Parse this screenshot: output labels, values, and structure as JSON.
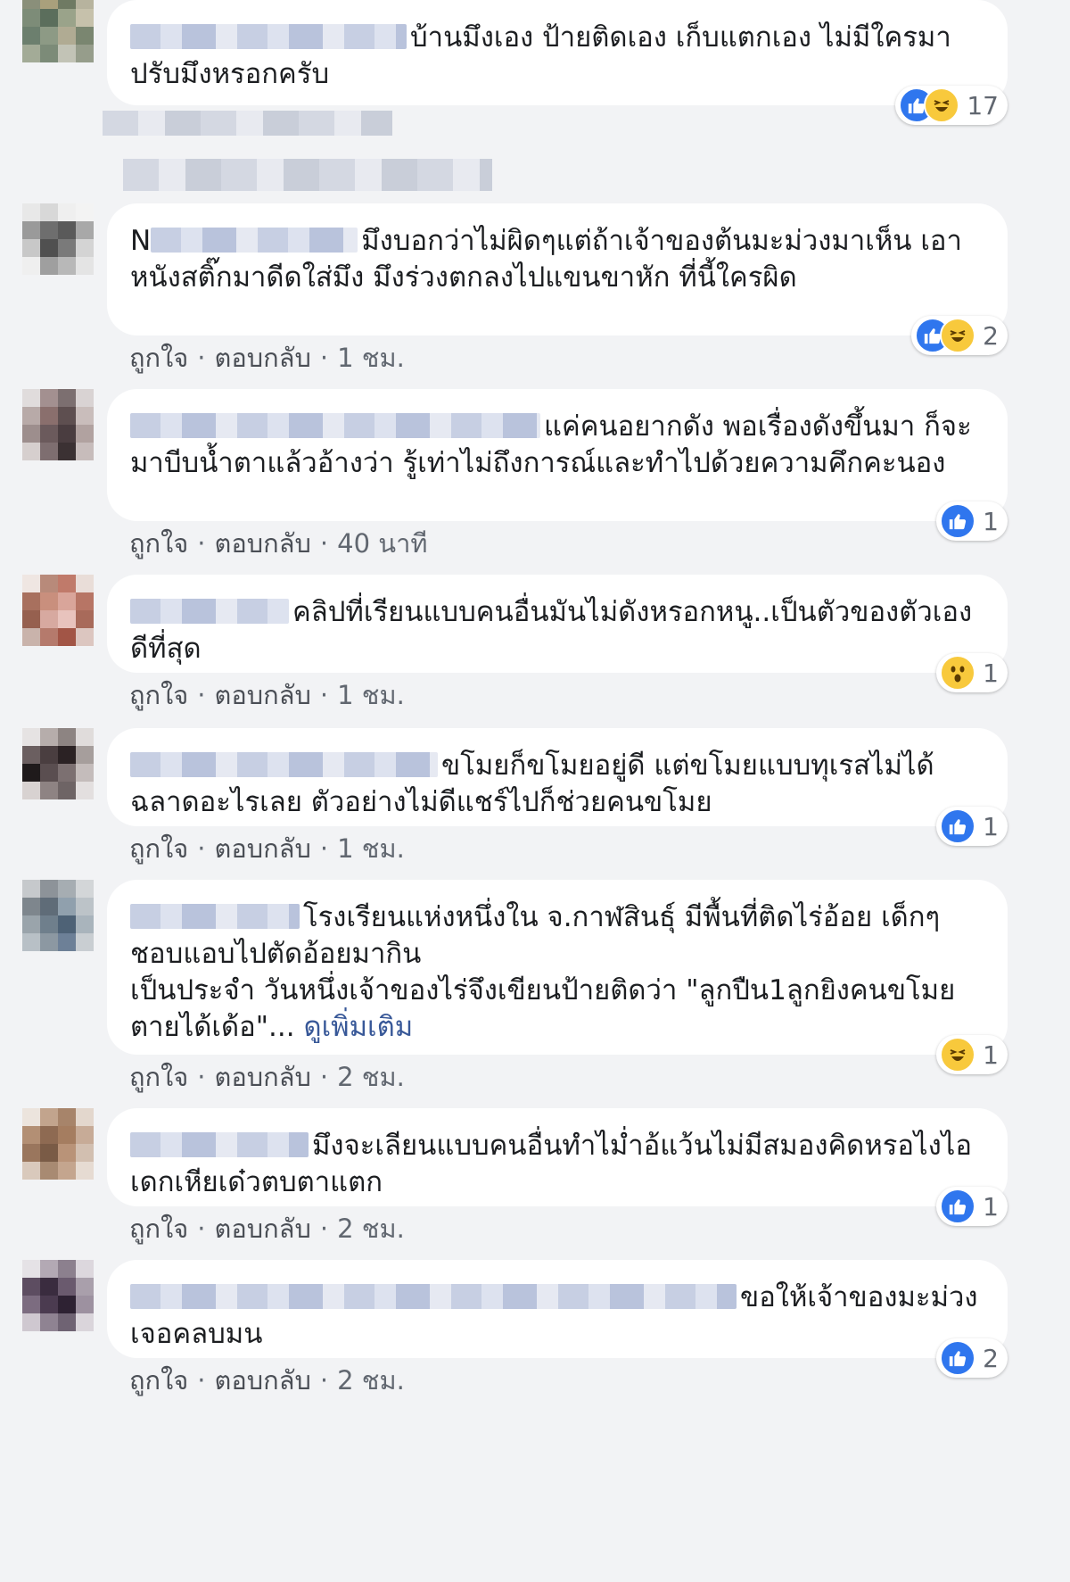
{
  "comments": [
    {
      "text": "บ้านมึงเอง ป้ายติดเอง เก็บแตกเอง ไม่มีใครมาปรับมึงหรอกครับ",
      "reactions": {
        "types": [
          "like",
          "haha"
        ],
        "count": "17"
      },
      "avatar_colors": [
        "#8a8f7a",
        "#a9a07c",
        "#6f7a63",
        "#b7b39e",
        "#7d8c78",
        "#5b6e5c",
        "#9aa38a",
        "#c6c1ab",
        "#6c7f6e",
        "#8d9a85",
        "#b0ab93",
        "#7a8670",
        "#a3ab97",
        "#7c8b78",
        "#c2c3b6",
        "#969d8b"
      ]
    },
    {
      "name_visible": "N",
      "text": "มึงบอกว่าไม่ผิดๆแต่ถ้าเจ้าของต้นมะม่วงมาเห็น เอาหนังสติ๊กมาดีดใส่มึง มึงร่วงตกลงไปแขนขาหัก ที่นี้ใครผิด",
      "reactions": {
        "types": [
          "like",
          "haha"
        ],
        "count": "2"
      },
      "actions": {
        "like": "ถูกใจ",
        "reply": "ตอบกลับ",
        "time": "1 ชม."
      },
      "avatar_colors": [
        "#e8e8e8",
        "#d8d8d8",
        "#efefef",
        "#f3f3f3",
        "#9a9a9a",
        "#6e6e6e",
        "#5a5a5a",
        "#a8a8a8",
        "#c8c8c8",
        "#505050",
        "#7a7a7a",
        "#d4d4d4",
        "#efefef",
        "#9f9f9f",
        "#b8b8b8",
        "#e4e4e4"
      ]
    },
    {
      "text": "แค่คนอยากดัง พอเรื่องดังขึ้นมา ก็จะมาบีบน้ำตาแล้วอ้างว่า รู้เท่าไม่ถึงการณ์และทำไปด้วยความคึกคะนอง",
      "reactions": {
        "types": [
          "like"
        ],
        "count": "1"
      },
      "actions": {
        "like": "ถูกใจ",
        "reply": "ตอบกลับ",
        "time": "40 นาที"
      },
      "avatar_colors": [
        "#e0dcdc",
        "#a39090",
        "#7c6f70",
        "#d9d3d3",
        "#b8aaa8",
        "#8a6f6d",
        "#5e4f50",
        "#c9bdbb",
        "#9d8e8d",
        "#6b5a5c",
        "#4a3d40",
        "#b1a2a0",
        "#d6cfce",
        "#7e6e70",
        "#3b3133",
        "#c7bcbb"
      ]
    },
    {
      "text": "คลิปที่เรียนแบบคนอื่นมันไม่ดังหรอกหนู..เป็นตัวของตัวเองดีที่สุด",
      "reactions": {
        "types": [
          "wow"
        ],
        "count": "1"
      },
      "actions": {
        "like": "ถูกใจ",
        "reply": "ตอบกลับ",
        "time": "1 ชม."
      },
      "avatar_colors": [
        "#efe6e2",
        "#b88a7a",
        "#c07a6a",
        "#e9ddd8",
        "#a8705e",
        "#c98f7d",
        "#d9a59a",
        "#b77565",
        "#96604f",
        "#d7a9a0",
        "#e8c3bd",
        "#a86a5a",
        "#c9b3ab",
        "#b57a6c",
        "#a25546",
        "#dcc6c0"
      ]
    },
    {
      "text": "ขโมยก็ขโมยอยู่ดี แต่ขโมยแบบทุเรสไม่ได้ฉลาดอะไรเลย ตัวอย่างไม่ดีแชร์ไปก็ช่วยคนขโมย",
      "reactions": {
        "types": [
          "like"
        ],
        "count": "1"
      },
      "actions": {
        "like": "ถูกใจ",
        "reply": "ตอบกลับ",
        "time": "1 ชม."
      },
      "avatar_colors": [
        "#e6e3e3",
        "#b6adab",
        "#8d8482",
        "#e0dcdb",
        "#6b5f60",
        "#4a3e40",
        "#2b2224",
        "#a69e9c",
        "#1f1a1b",
        "#5a4e50",
        "#7c7071",
        "#c4bcbb",
        "#d8d2d1",
        "#8e8383",
        "#6e6465",
        "#e3dfdf"
      ]
    },
    {
      "text": "โรงเรียนแห่งหนึ่งใน จ.กาฬสินธุ์ มีพื้นที่ติดไร่อ้อย เด็กๆชอบแอบไปตัดอ้อยมากิน\nเป็นประจำ วันหนึ่งเจ้าของไร่จึงเขียนป้ายติดว่า \"ลูกปืน1ลูกยิงคนขโมยตายได้เด้อ\"... ",
      "see_more": "ดูเพิ่มเติม",
      "reactions": {
        "types": [
          "haha"
        ],
        "count": "1"
      },
      "actions": {
        "like": "ถูกใจ",
        "reply": "ตอบกลับ",
        "time": "2 ชม."
      },
      "avatar_colors": [
        "#c6c9cc",
        "#8d9399",
        "#a6adb2",
        "#d3d6d8",
        "#7e868d",
        "#5f6c78",
        "#90a0ad",
        "#bcc3c8",
        "#9aa4ab",
        "#6f7f8c",
        "#4e6276",
        "#a9b4bc",
        "#b8c0c6",
        "#8c98a2",
        "#6d8097",
        "#c9ced2"
      ]
    },
    {
      "text": "มึงจะเลียนแบบคนอื่นทำไม่ำอ้แว้นไม่มีสมองคิดหรอไงไอเดกเหียเด๋วตบตาแตก",
      "reactions": {
        "types": [
          "like"
        ],
        "count": "1"
      },
      "actions": {
        "like": "ถูกใจ",
        "reply": "ตอบกลับ",
        "time": "2 ชม."
      },
      "avatar_colors": [
        "#ece4dd",
        "#c2a48d",
        "#a7846a",
        "#e3d7cd",
        "#b38f74",
        "#8e6a52",
        "#a57d60",
        "#c7ab97",
        "#9a765d",
        "#7a5b46",
        "#b99378",
        "#d2bfb0",
        "#d9c9bc",
        "#a88a72",
        "#c4a58e",
        "#e6dbd2"
      ]
    },
    {
      "text": "ขอให้เจ้าของมะม่วงเจอคลบมน",
      "reactions": {
        "types": [
          "like"
        ],
        "count": "2"
      },
      "actions": {
        "like": "ถูกใจ",
        "reply": "ตอบกลับ",
        "time": "2 ชม."
      },
      "avatar_colors": [
        "#e5e2e6",
        "#b3a9b4",
        "#8c808e",
        "#dcd7dd",
        "#5d4d61",
        "#3a2c3f",
        "#6a5a6e",
        "#a99fab",
        "#7c6c80",
        "#4b3b50",
        "#2e2233",
        "#9d91a0",
        "#cfc8d0",
        "#8f8392",
        "#6f6373",
        "#dad5db"
      ]
    }
  ]
}
